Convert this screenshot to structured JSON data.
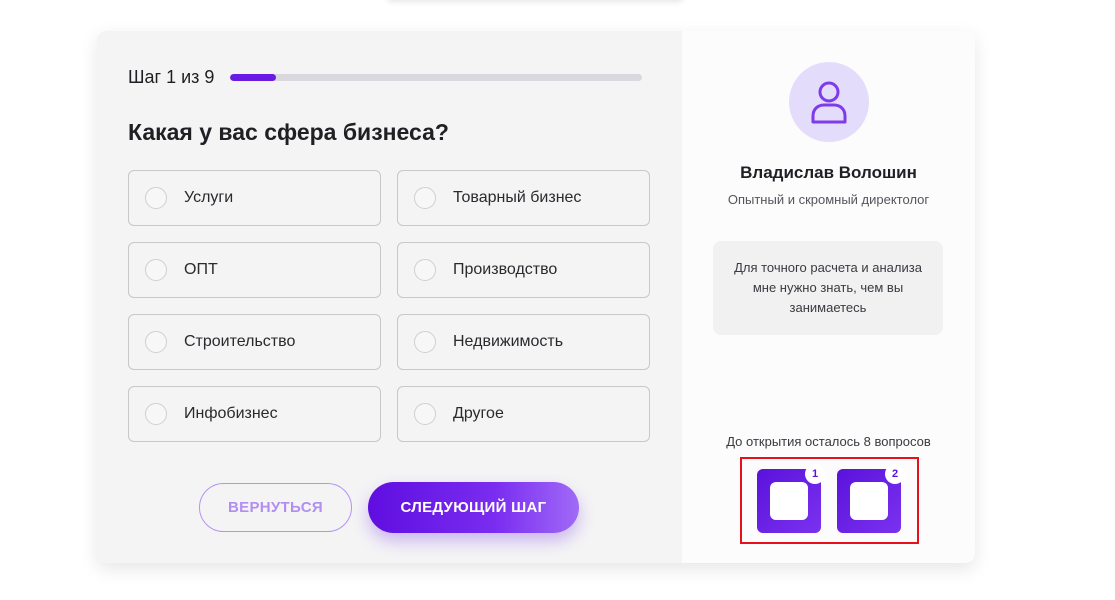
{
  "quiz": {
    "step_label": "Шаг 1 из 9",
    "progress_fraction": 0.11,
    "question": "Какая у вас сфера бизнеса?",
    "options": [
      {
        "label": "Услуги"
      },
      {
        "label": "Товарный бизнес"
      },
      {
        "label": "ОПТ"
      },
      {
        "label": "Производство"
      },
      {
        "label": "Строительство"
      },
      {
        "label": "Недвижимость"
      },
      {
        "label": "Инфобизнес"
      },
      {
        "label": "Другое"
      }
    ],
    "back_label": "ВЕРНУТЬСЯ",
    "next_label": "СЛЕДУЮЩИЙ ШАГ"
  },
  "expert": {
    "avatar_icon": "user-icon",
    "name": "Владислав Волошин",
    "role": "Опытный и скромный директолог",
    "message": "Для точного расчета и анализа мне нужно знать, чем вы занимаетесь"
  },
  "gifts": {
    "remaining_text": "До открытия осталось 8 вопросов",
    "items": [
      {
        "badge": "1"
      },
      {
        "badge": "2"
      }
    ]
  },
  "colors": {
    "accent": "#6a1be3",
    "highlight_frame": "#e8101a"
  }
}
